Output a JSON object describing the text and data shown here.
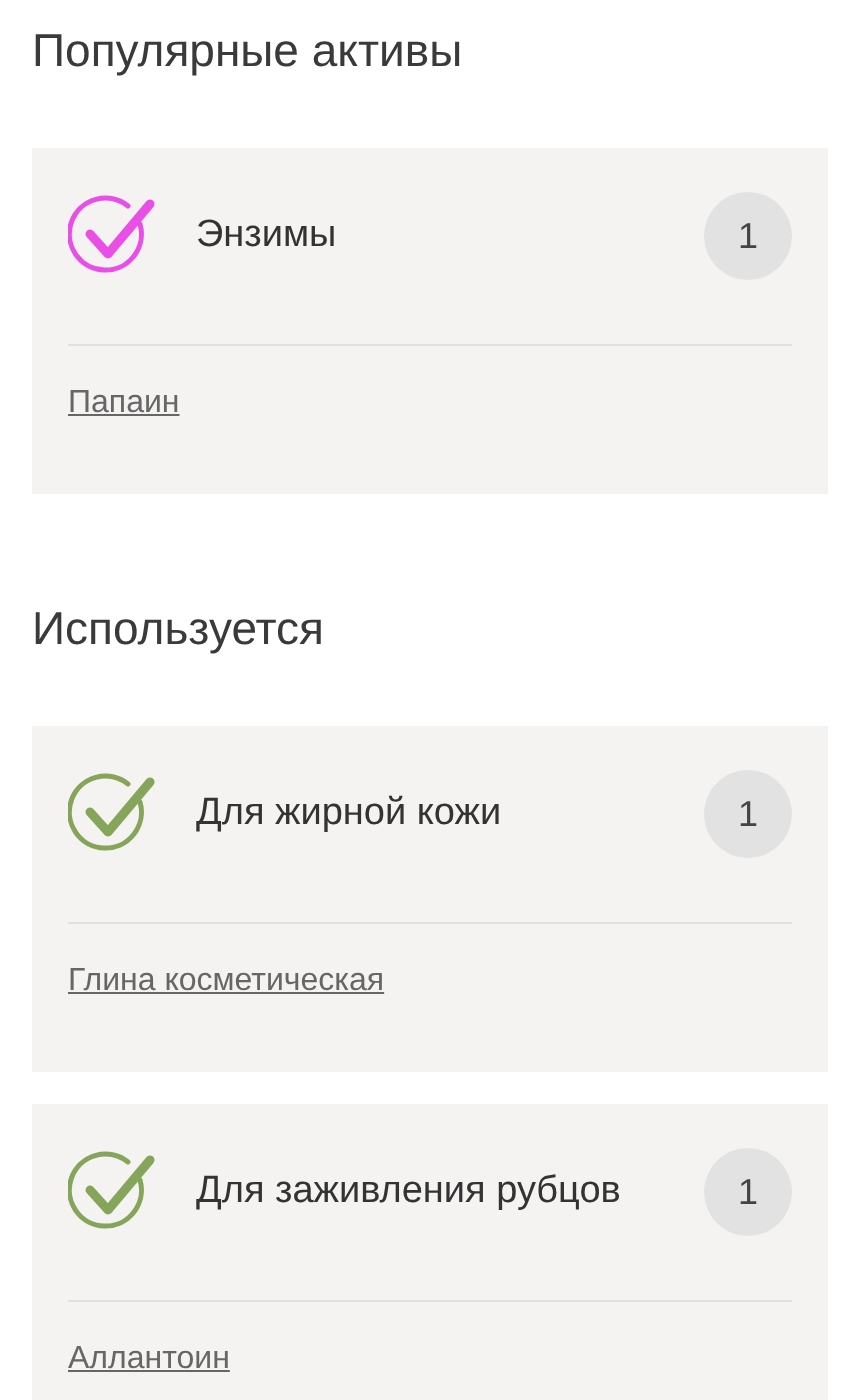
{
  "sections": [
    {
      "title": "Популярные активы",
      "cards": [
        {
          "label": "Энзимы",
          "count": "1",
          "color": "#e94fe6",
          "links": [
            "Папаин"
          ]
        }
      ]
    },
    {
      "title": "Используется",
      "cards": [
        {
          "label": "Для жирной кожи",
          "count": "1",
          "color": "#84a55a",
          "links": [
            "Глина косметическая"
          ]
        },
        {
          "label": "Для заживления рубцов",
          "count": "1",
          "color": "#84a55a",
          "links": [
            "Аллантоин"
          ]
        }
      ]
    }
  ]
}
